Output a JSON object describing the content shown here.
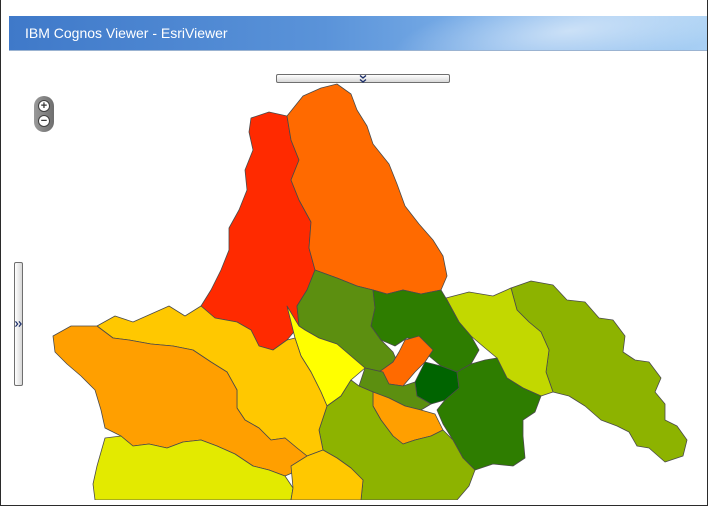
{
  "window": {
    "title": "IBM Cognos Viewer - EsriViewer"
  },
  "map_controls": {
    "zoom_in_symbol": "+",
    "zoom_out_symbol": "−",
    "collapse_top_icon": "double-chevron-down-icon",
    "collapse_side_icon": "double-chevron-right-icon"
  },
  "map": {
    "colors": {
      "red": "#ff2a00",
      "orange_red": "#ff6a00",
      "orange": "#ff9f00",
      "amber": "#ffc800",
      "yellow": "#ffff00",
      "lime_yellow": "#e3ea00",
      "light_green": "#c2d800",
      "yellow_green": "#8db300",
      "mid_green": "#5c8f10",
      "green": "#2e7d00",
      "dark_green": "#006400",
      "border": "#4a4a4a"
    }
  }
}
